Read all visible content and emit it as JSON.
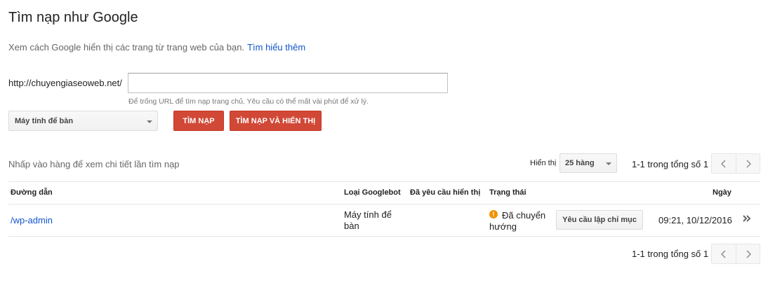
{
  "page": {
    "title": "Tìm nạp như Google",
    "description": "Xem cách Google hiển thị các trang từ trang web của bạn.",
    "learn_more": "Tìm hiểu thêm"
  },
  "form": {
    "url_prefix": "http://chuyengiaseoweb.net/",
    "url_value": "",
    "hint": "Để trống URL để tìm nạp trang chủ. Yêu cầu có thể mất vài phút để xử lý.",
    "device_selected": "Máy tính để bàn",
    "fetch_label": "TÌM NẠP",
    "fetch_render_label": "TÌM NẠP VÀ HIỂN THỊ"
  },
  "list": {
    "click_hint": "Nhấp vào hàng để xem chi tiết lần tìm nạp",
    "show_label": "Hiển thị",
    "rows_selected": "25 hàng",
    "pager_text_top": "1-1 trong tổng số 1",
    "pager_text_bottom": "1-1 trong tổng số 1",
    "headers": {
      "path": "Đường dẫn",
      "googlebot_type": "Loại Googlebot",
      "render_requested": "Đã yêu cầu hiển thị",
      "status": "Trạng thái",
      "date": "Ngày"
    },
    "rows": [
      {
        "path": "/wp-admin",
        "googlebot_line1": "Máy tính để",
        "googlebot_line2": "bàn",
        "render_requested": "",
        "status_line1": "Đã chuyển",
        "status_line2": "hướng",
        "action_label": "Yêu cầu lập chỉ mục",
        "date": "09:21, 10/12/2016"
      }
    ]
  },
  "icons": {
    "warning": "warning-icon",
    "prev": "chevron-left-icon",
    "next": "chevron-right-icon",
    "expand": "double-chevron-right-icon"
  },
  "colors": {
    "primary_red": "#d14836",
    "link_blue": "#1155cc",
    "warning_orange": "#f09300"
  }
}
